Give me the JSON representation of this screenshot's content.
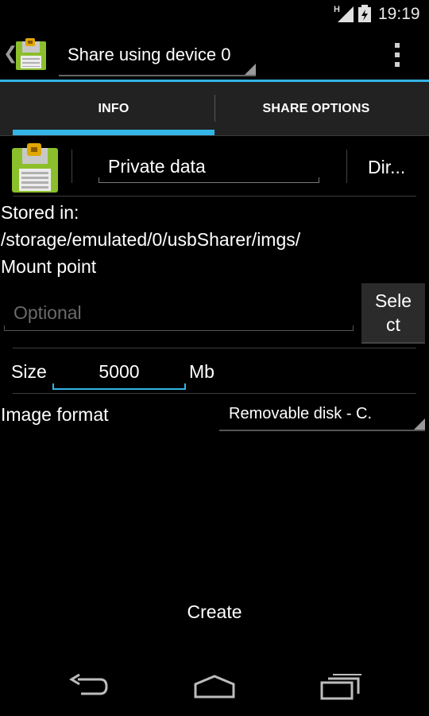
{
  "status_bar": {
    "network_type": "H",
    "time": "19:19",
    "icons": [
      "signal-icon",
      "battery-icon"
    ]
  },
  "action_bar": {
    "back_icon": "back-caret-icon",
    "app_icon": "floppy-disk-lock-icon",
    "spinner_label": "Share using device 0",
    "overflow_icon": "overflow-menu-icon"
  },
  "tabs": [
    {
      "label": "INFO",
      "selected": true
    },
    {
      "label": "SHARE OPTIONS",
      "selected": false
    }
  ],
  "image": {
    "icon": "floppy-disk-lock-icon",
    "name": "Private data",
    "dir_button": "Dir..."
  },
  "storage": {
    "stored_in_label": "Stored in:",
    "path": "/storage/emulated/0/usbSharer/imgs/"
  },
  "mount": {
    "label": "Mount point",
    "placeholder": "Optional",
    "value": "",
    "select_button": "Sele ct"
  },
  "size": {
    "label": "Size",
    "value": "5000",
    "unit": "Mb"
  },
  "format": {
    "label": "Image format",
    "selected": "Removable disk - C."
  },
  "create_button": "Create",
  "nav_bar": {
    "back": "nav-back-icon",
    "home": "nav-home-icon",
    "recents": "nav-recents-icon"
  },
  "colors": {
    "accent": "#33b5e5",
    "background": "#000000",
    "tab_bar": "#222222"
  }
}
